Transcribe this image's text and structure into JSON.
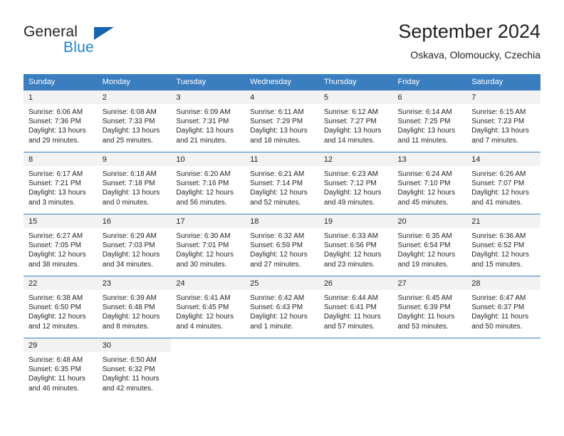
{
  "brand": {
    "name_top": "General",
    "name_bottom": "Blue",
    "logo_icon": "triangle-logo-icon",
    "color_blue": "#1f7fd4",
    "color_dark": "#231f20"
  },
  "header": {
    "title": "September 2024",
    "subtitle": "Oskava, Olomoucky, Czechia"
  },
  "theme": {
    "header_bg": "#3a7ec0",
    "daynum_bg": "#f2f2f2",
    "text": "#231f20"
  },
  "weekdays": [
    "Sunday",
    "Monday",
    "Tuesday",
    "Wednesday",
    "Thursday",
    "Friday",
    "Saturday"
  ],
  "labels": {
    "sunrise": "Sunrise:",
    "sunset": "Sunset:",
    "daylight": "Daylight:"
  },
  "weeks": [
    [
      {
        "day": "1",
        "sunrise": "Sunrise: 6:06 AM",
        "sunset": "Sunset: 7:36 PM",
        "daylight": "Daylight: 13 hours and 29 minutes."
      },
      {
        "day": "2",
        "sunrise": "Sunrise: 6:08 AM",
        "sunset": "Sunset: 7:33 PM",
        "daylight": "Daylight: 13 hours and 25 minutes."
      },
      {
        "day": "3",
        "sunrise": "Sunrise: 6:09 AM",
        "sunset": "Sunset: 7:31 PM",
        "daylight": "Daylight: 13 hours and 21 minutes."
      },
      {
        "day": "4",
        "sunrise": "Sunrise: 6:11 AM",
        "sunset": "Sunset: 7:29 PM",
        "daylight": "Daylight: 13 hours and 18 minutes."
      },
      {
        "day": "5",
        "sunrise": "Sunrise: 6:12 AM",
        "sunset": "Sunset: 7:27 PM",
        "daylight": "Daylight: 13 hours and 14 minutes."
      },
      {
        "day": "6",
        "sunrise": "Sunrise: 6:14 AM",
        "sunset": "Sunset: 7:25 PM",
        "daylight": "Daylight: 13 hours and 11 minutes."
      },
      {
        "day": "7",
        "sunrise": "Sunrise: 6:15 AM",
        "sunset": "Sunset: 7:23 PM",
        "daylight": "Daylight: 13 hours and 7 minutes."
      }
    ],
    [
      {
        "day": "8",
        "sunrise": "Sunrise: 6:17 AM",
        "sunset": "Sunset: 7:21 PM",
        "daylight": "Daylight: 13 hours and 3 minutes."
      },
      {
        "day": "9",
        "sunrise": "Sunrise: 6:18 AM",
        "sunset": "Sunset: 7:18 PM",
        "daylight": "Daylight: 13 hours and 0 minutes."
      },
      {
        "day": "10",
        "sunrise": "Sunrise: 6:20 AM",
        "sunset": "Sunset: 7:16 PM",
        "daylight": "Daylight: 12 hours and 56 minutes."
      },
      {
        "day": "11",
        "sunrise": "Sunrise: 6:21 AM",
        "sunset": "Sunset: 7:14 PM",
        "daylight": "Daylight: 12 hours and 52 minutes."
      },
      {
        "day": "12",
        "sunrise": "Sunrise: 6:23 AM",
        "sunset": "Sunset: 7:12 PM",
        "daylight": "Daylight: 12 hours and 49 minutes."
      },
      {
        "day": "13",
        "sunrise": "Sunrise: 6:24 AM",
        "sunset": "Sunset: 7:10 PM",
        "daylight": "Daylight: 12 hours and 45 minutes."
      },
      {
        "day": "14",
        "sunrise": "Sunrise: 6:26 AM",
        "sunset": "Sunset: 7:07 PM",
        "daylight": "Daylight: 12 hours and 41 minutes."
      }
    ],
    [
      {
        "day": "15",
        "sunrise": "Sunrise: 6:27 AM",
        "sunset": "Sunset: 7:05 PM",
        "daylight": "Daylight: 12 hours and 38 minutes."
      },
      {
        "day": "16",
        "sunrise": "Sunrise: 6:29 AM",
        "sunset": "Sunset: 7:03 PM",
        "daylight": "Daylight: 12 hours and 34 minutes."
      },
      {
        "day": "17",
        "sunrise": "Sunrise: 6:30 AM",
        "sunset": "Sunset: 7:01 PM",
        "daylight": "Daylight: 12 hours and 30 minutes."
      },
      {
        "day": "18",
        "sunrise": "Sunrise: 6:32 AM",
        "sunset": "Sunset: 6:59 PM",
        "daylight": "Daylight: 12 hours and 27 minutes."
      },
      {
        "day": "19",
        "sunrise": "Sunrise: 6:33 AM",
        "sunset": "Sunset: 6:56 PM",
        "daylight": "Daylight: 12 hours and 23 minutes."
      },
      {
        "day": "20",
        "sunrise": "Sunrise: 6:35 AM",
        "sunset": "Sunset: 6:54 PM",
        "daylight": "Daylight: 12 hours and 19 minutes."
      },
      {
        "day": "21",
        "sunrise": "Sunrise: 6:36 AM",
        "sunset": "Sunset: 6:52 PM",
        "daylight": "Daylight: 12 hours and 15 minutes."
      }
    ],
    [
      {
        "day": "22",
        "sunrise": "Sunrise: 6:38 AM",
        "sunset": "Sunset: 6:50 PM",
        "daylight": "Daylight: 12 hours and 12 minutes."
      },
      {
        "day": "23",
        "sunrise": "Sunrise: 6:39 AM",
        "sunset": "Sunset: 6:48 PM",
        "daylight": "Daylight: 12 hours and 8 minutes."
      },
      {
        "day": "24",
        "sunrise": "Sunrise: 6:41 AM",
        "sunset": "Sunset: 6:45 PM",
        "daylight": "Daylight: 12 hours and 4 minutes."
      },
      {
        "day": "25",
        "sunrise": "Sunrise: 6:42 AM",
        "sunset": "Sunset: 6:43 PM",
        "daylight": "Daylight: 12 hours and 1 minute."
      },
      {
        "day": "26",
        "sunrise": "Sunrise: 6:44 AM",
        "sunset": "Sunset: 6:41 PM",
        "daylight": "Daylight: 11 hours and 57 minutes."
      },
      {
        "day": "27",
        "sunrise": "Sunrise: 6:45 AM",
        "sunset": "Sunset: 6:39 PM",
        "daylight": "Daylight: 11 hours and 53 minutes."
      },
      {
        "day": "28",
        "sunrise": "Sunrise: 6:47 AM",
        "sunset": "Sunset: 6:37 PM",
        "daylight": "Daylight: 11 hours and 50 minutes."
      }
    ],
    [
      {
        "day": "29",
        "sunrise": "Sunrise: 6:48 AM",
        "sunset": "Sunset: 6:35 PM",
        "daylight": "Daylight: 11 hours and 46 minutes."
      },
      {
        "day": "30",
        "sunrise": "Sunrise: 6:50 AM",
        "sunset": "Sunset: 6:32 PM",
        "daylight": "Daylight: 11 hours and 42 minutes."
      },
      {
        "day": "",
        "sunrise": "",
        "sunset": "",
        "daylight": ""
      },
      {
        "day": "",
        "sunrise": "",
        "sunset": "",
        "daylight": ""
      },
      {
        "day": "",
        "sunrise": "",
        "sunset": "",
        "daylight": ""
      },
      {
        "day": "",
        "sunrise": "",
        "sunset": "",
        "daylight": ""
      },
      {
        "day": "",
        "sunrise": "",
        "sunset": "",
        "daylight": ""
      }
    ]
  ]
}
